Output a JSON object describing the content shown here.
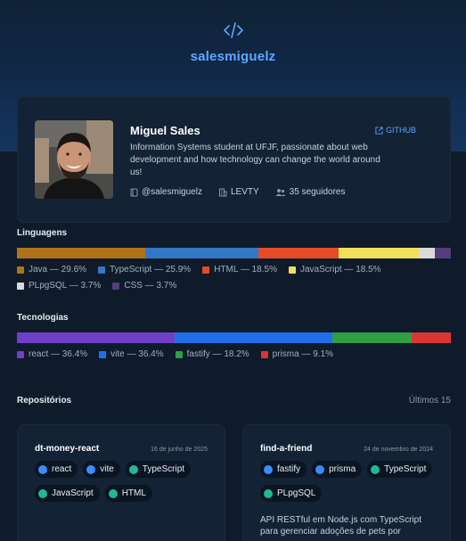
{
  "brand": "salesmiguelz",
  "profile": {
    "name": "Miguel Sales",
    "bio": "Information Systems student at UFJF, passionate about web development and how technology can change the world around us!",
    "github_label": "GITHUB",
    "handle": "@salesmiguelz",
    "company": "LEVTY",
    "followers": "35 seguidores"
  },
  "languages": {
    "title": "Linguagens",
    "items": [
      {
        "label": "Java — 29.6%",
        "value": 29.6,
        "color": "#b07219"
      },
      {
        "label": "TypeScript — 25.9%",
        "value": 25.9,
        "color": "#3178c6"
      },
      {
        "label": "HTML — 18.5%",
        "value": 18.5,
        "color": "#e34c26"
      },
      {
        "label": "JavaScript — 18.5%",
        "value": 18.5,
        "color": "#f1e05a"
      },
      {
        "label": "PLpgSQL — 3.7%",
        "value": 3.7,
        "color": "#dadada"
      },
      {
        "label": "CSS — 3.7%",
        "value": 3.7,
        "color": "#563d7c"
      }
    ]
  },
  "technologies": {
    "title": "Tecnologias",
    "items": [
      {
        "label": "react — 36.4%",
        "value": 36.4,
        "color": "#6e40c9"
      },
      {
        "label": "vite — 36.4%",
        "value": 36.4,
        "color": "#1f6feb"
      },
      {
        "label": "fastify — 18.2%",
        "value": 18.2,
        "color": "#2ea043"
      },
      {
        "label": "prisma — 9.1%",
        "value": 9.1,
        "color": "#da3633"
      }
    ]
  },
  "repos": {
    "title": "Repositórios",
    "count_label": "Últimos 15",
    "cards": [
      {
        "name": "dt-money-react",
        "date": "16 de junho de 2025",
        "tags": [
          {
            "label": "react",
            "dot": "blue"
          },
          {
            "label": "vite",
            "dot": "blue"
          },
          {
            "label": "TypeScript",
            "dot": "green"
          },
          {
            "label": "JavaScript",
            "dot": "green"
          },
          {
            "label": "HTML",
            "dot": "green"
          }
        ],
        "description": ""
      },
      {
        "name": "find-a-friend",
        "date": "24 de novembro de 2024",
        "tags": [
          {
            "label": "fastify",
            "dot": "blue"
          },
          {
            "label": "prisma",
            "dot": "blue"
          },
          {
            "label": "TypeScript",
            "dot": "green"
          },
          {
            "label": "PLpgSQL",
            "dot": "green"
          }
        ],
        "description": "API RESTful em Node.js com TypeScript para gerenciar adoções de pets por"
      }
    ]
  }
}
